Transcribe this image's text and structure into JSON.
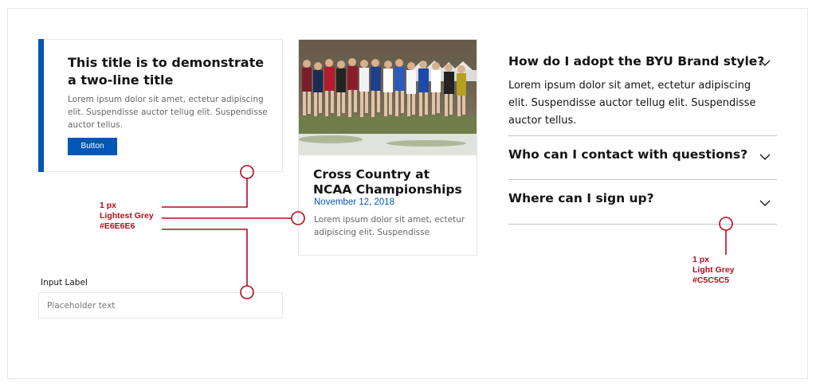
{
  "card1": {
    "title": "This title is to demonstrate a two-line title",
    "body": "Lorem ipsum dolor sit amet, ectetur adipiscing elit. Suspendisse auctor tellug elit. Suspendisse auctor tellus.",
    "button_label": "Button"
  },
  "card2": {
    "image_alt": "cross-country-runners-photo",
    "title": "Cross Country at NCAA Championships",
    "date": "November 12, 2018",
    "body": "Lorem ipsum dolor sit amet, ectetur adipiscing elit. Suspendisse"
  },
  "input": {
    "label": "Input Label",
    "placeholder": "Placeholder text"
  },
  "accordion": {
    "items": [
      {
        "question": "How do I adopt the BYU Brand style?",
        "answer": "Lorem ipsum dolor sit amet, ectetur adipiscing elit. Suspendisse auctor tellug elit. Suspendisse auctor tellus.",
        "expanded": true
      },
      {
        "question": "Who can I contact with questions?",
        "expanded": false
      },
      {
        "question": "Where can I sign up?",
        "expanded": false
      }
    ]
  },
  "annotations": {
    "lightest_grey": {
      "size": "1 px",
      "name": "Lightest Grey",
      "hex": "#E6E6E6"
    },
    "light_grey": {
      "size": "1 px",
      "name": "Light Grey",
      "hex": "#C5C5C5"
    }
  },
  "colors": {
    "brand_blue": "#0057b8",
    "annotation_red": "#b30d1c",
    "lightest_grey": "#e6e6e6",
    "light_grey": "#c5c5c5"
  }
}
